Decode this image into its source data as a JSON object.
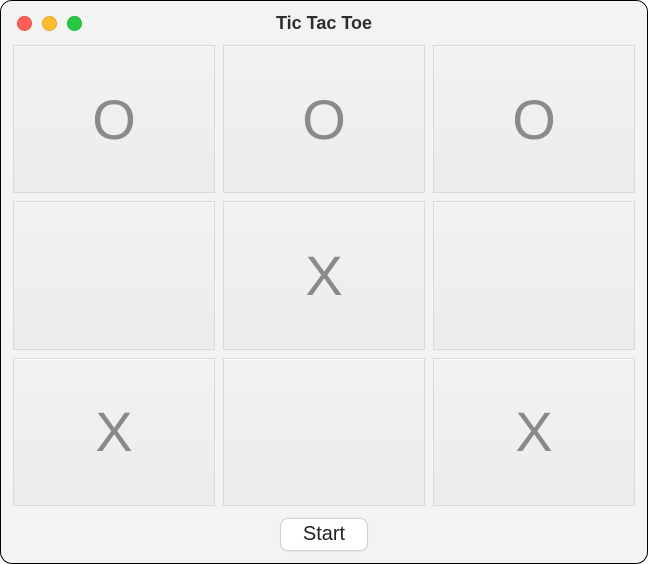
{
  "window": {
    "title": "Tic Tac Toe"
  },
  "board": {
    "cells": [
      "O",
      "O",
      "O",
      "",
      "X",
      "",
      "X",
      "",
      "X"
    ]
  },
  "footer": {
    "start_label": "Start"
  }
}
